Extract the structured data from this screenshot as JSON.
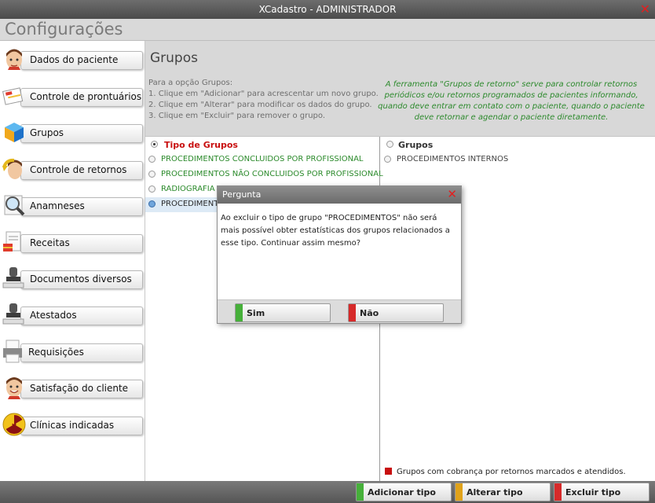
{
  "app": {
    "window_title": "XCadastro - ADMINISTRADOR",
    "close_glyph": "✕",
    "section_title": "Configurações"
  },
  "sidebar": {
    "items": [
      {
        "label": "Dados do paciente",
        "icon": "patient-face-icon"
      },
      {
        "label": "Controle de prontuários",
        "icon": "records-icon"
      },
      {
        "label": "Grupos",
        "icon": "cube-icon"
      },
      {
        "label": "Controle de retornos",
        "icon": "return-arrow-icon"
      },
      {
        "label": "Anamneses",
        "icon": "magnifier-icon"
      },
      {
        "label": "Receitas",
        "icon": "prescription-icon"
      },
      {
        "label": "Documentos diversos",
        "icon": "stamp-icon"
      },
      {
        "label": "Atestados",
        "icon": "stamp-icon"
      },
      {
        "label": "Requisições",
        "icon": "printer-icon"
      },
      {
        "label": "Satisfação do cliente",
        "icon": "smiling-face-icon"
      },
      {
        "label": "Clínicas indicadas",
        "icon": "radiation-icon"
      }
    ]
  },
  "main": {
    "heading": "Grupos",
    "instructions": [
      "Para a opção Grupos:",
      "1. Clique em \"Adicionar\" para acrescentar um novo grupo.",
      "2. Clique em \"Alterar\" para modificar os dados do grupo.",
      "3. Clique em \"Excluir\" para remover o grupo."
    ],
    "note": "A ferramenta \"Grupos de retorno\" serve para controlar retornos periódicos e/ou retornos programados de pacientes informando, quando deve entrar em contato com o paciente, quando o paciente deve retornar e agendar o paciente diretamente.",
    "left_header": "Tipo de Grupos",
    "left_rows": [
      "PROCEDIMENTOS CONCLUIDOS POR PROFISSIONAL",
      "PROCEDIMENTOS NÃO CONCLUIDOS POR PROFISSIONAL",
      "RADIOGRAFIA",
      "PROCEDIMENTOS"
    ],
    "selected_row_index": 3,
    "right_header": "Grupos",
    "right_rows": [
      "PROCEDIMENTOS INTERNOS"
    ],
    "legend": "Grupos com cobrança por retornos marcados e atendidos.",
    "legend_color": "#c81010"
  },
  "bottom": {
    "add": "Adicionar tipo",
    "edit": "Alterar tipo",
    "delete": "Excluir tipo",
    "add_color": "#46b03a",
    "edit_color": "#e0a21a",
    "delete_color": "#d62a2a"
  },
  "dialog": {
    "title": "Pergunta",
    "message": "Ao excluir o tipo de grupo \"PROCEDIMENTOS\" não será mais possível obter estatísticas dos grupos relacionados a esse tipo. Continuar assim mesmo?",
    "yes": "Sim",
    "no": "Não"
  }
}
